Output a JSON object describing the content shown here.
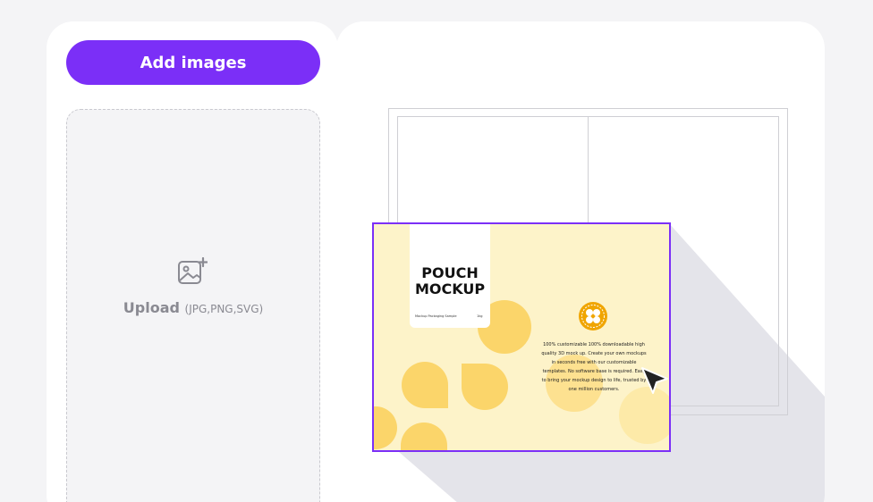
{
  "sidebar": {
    "add_button_label": "Add images",
    "upload_label": "Upload",
    "upload_formats": "(JPG,PNG,SVG)"
  },
  "mockup": {
    "title_line1": "POUCH",
    "title_line2": "MOCKUP",
    "small_left": "Mockup Packaging Sample",
    "small_right": "1kg",
    "description": "100% customizable 100% downloadable high quality 3D mock up. Create your own mockups in seconds free with our customizable templates. No software base is required. Easy to bring your mockup design to life, trusted by one million customers."
  },
  "colors": {
    "accent": "#7b2ff7",
    "mockup_bg": "#fdf3c9",
    "shape_yellow": "#fbd56a",
    "emblem_orange": "#f0a500"
  },
  "icons": {
    "upload": "image-add-icon",
    "cursor": "cursor-arrow-icon"
  }
}
